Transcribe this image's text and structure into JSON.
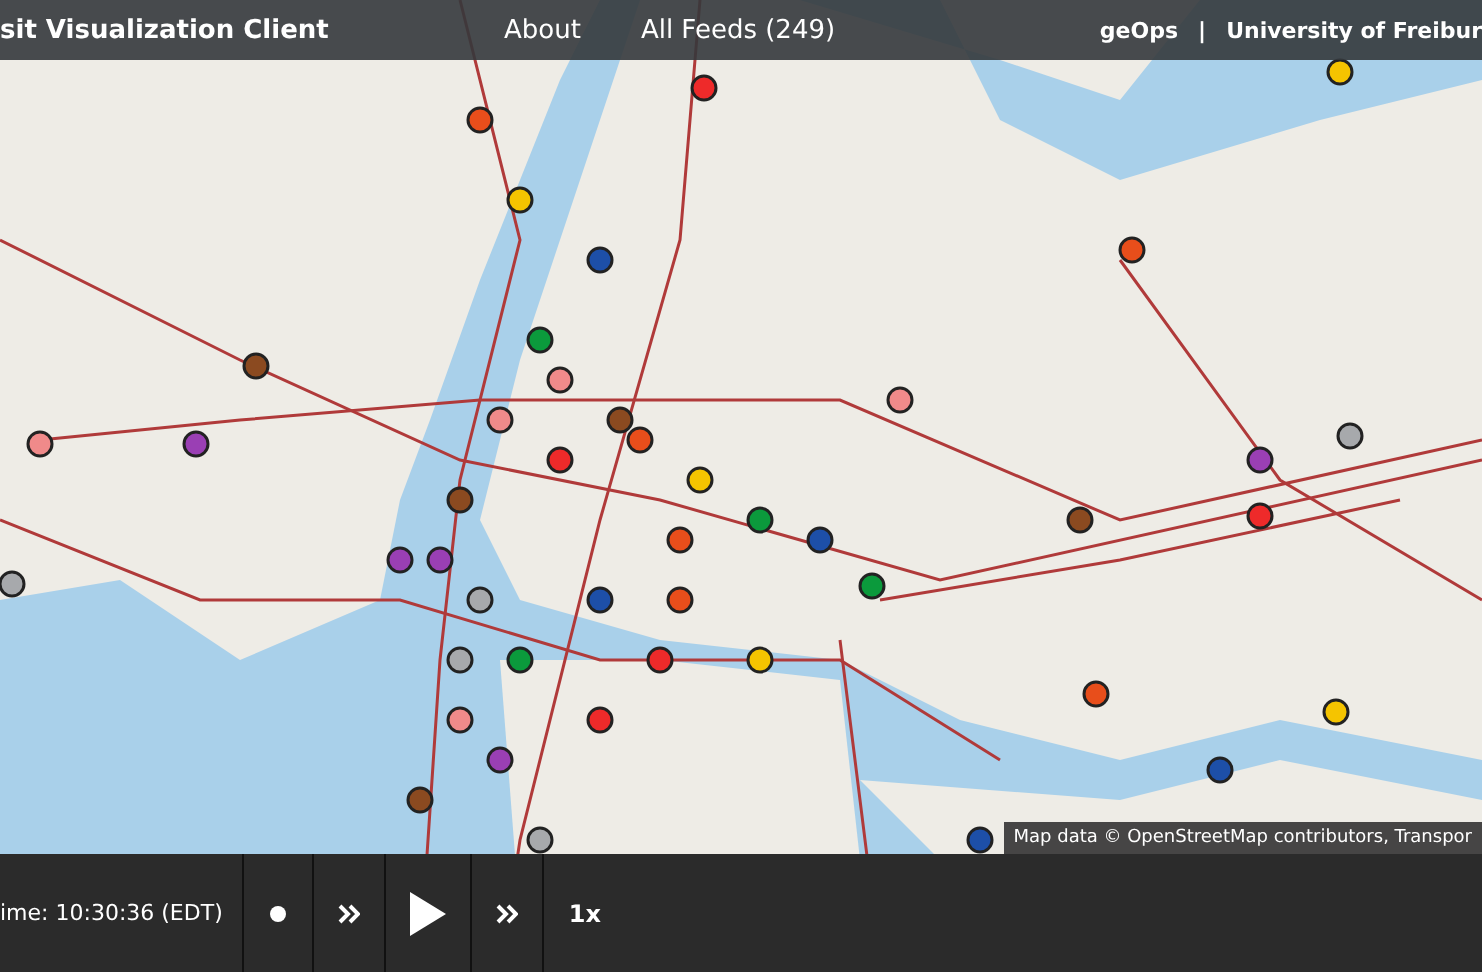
{
  "navbar": {
    "title": "sit Visualization Client",
    "links": [
      {
        "label": "About"
      },
      {
        "label": "All Feeds (249)"
      }
    ],
    "credits": [
      {
        "label": "geOps"
      },
      {
        "label": "|"
      },
      {
        "label": "University of Freibur"
      }
    ]
  },
  "map": {
    "attribution": "Map data © OpenStreetMap contributors, Transpor"
  },
  "player": {
    "time": "ime: 10:30:36 (EDT)",
    "controls": [
      {
        "kind": "dot"
      },
      {
        "kind": "back"
      },
      {
        "kind": "play"
      },
      {
        "kind": "forward"
      },
      {
        "kind": "text",
        "label": "1x"
      }
    ]
  }
}
